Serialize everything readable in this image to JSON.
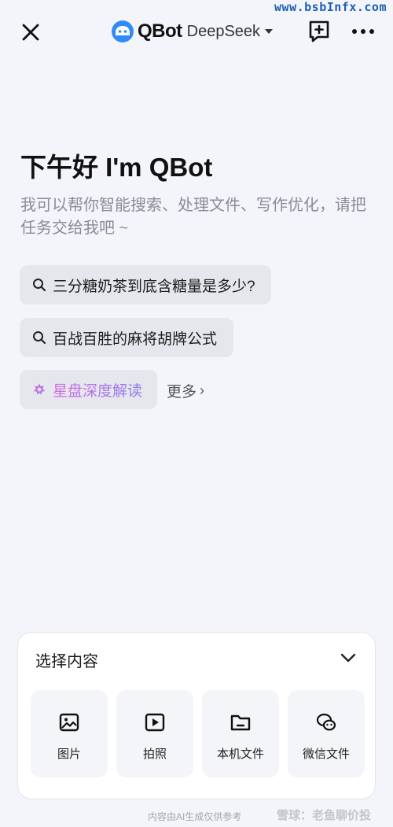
{
  "watermark_top": "www.bsbInfx.com",
  "header": {
    "brand_name": "QBot",
    "model": "DeepSeek"
  },
  "greeting": {
    "title": "下午好 I'm QBot",
    "subtitle": "我可以帮你智能搜索、处理文件、写作优化，请把任务交给我吧 ~"
  },
  "suggestions": [
    {
      "label": "三分糖奶茶到底含糖量是多少?",
      "icon": "search-icon"
    },
    {
      "label": "百战百胜的麻将胡牌公式",
      "icon": "search-icon"
    },
    {
      "label": "星盘深度解读",
      "icon": "sparkle-icon"
    }
  ],
  "more_label": "更多",
  "panel": {
    "title": "选择内容",
    "tiles": [
      {
        "label": "图片",
        "icon": "image-icon"
      },
      {
        "label": "拍照",
        "icon": "video-icon"
      },
      {
        "label": "本机文件",
        "icon": "folder-icon"
      },
      {
        "label": "微信文件",
        "icon": "wechat-icon"
      }
    ]
  },
  "disclaimer": "内容由AI生成仅供参考",
  "watermark_bottom": "雪球：老鱼聊价投",
  "colors": {
    "background": "#f4f5fa",
    "chip": "#e6e7ec",
    "accent_gradient_start": "#d46be0",
    "accent_gradient_end": "#8a7cf0",
    "brand_blue": "#2f8cf5"
  }
}
